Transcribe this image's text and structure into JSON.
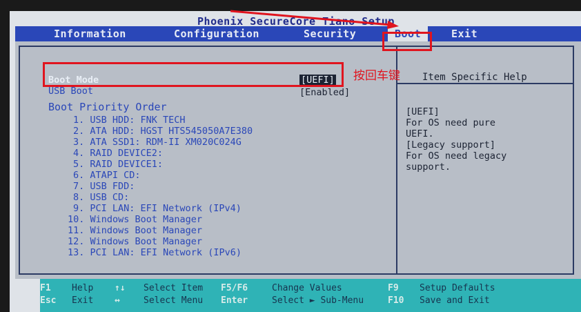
{
  "title": "Phoenix SecureCore Tiano Setup",
  "menu": [
    "Information",
    "Configuration",
    "Security",
    "Boot",
    "Exit"
  ],
  "active_tab": "Boot",
  "settings": {
    "boot_mode": {
      "label": "Boot Mode",
      "value": "[UEFI]"
    },
    "usb_boot": {
      "label": "USB Boot",
      "value": "[Enabled]"
    }
  },
  "boot_priority_heading": "Boot Priority Order",
  "boot_items": [
    "1. USB HDD: FNK TECH",
    "2. ATA HDD: HGST HTS545050A7E380",
    "3. ATA SSD1: RDM-II XM020C024G",
    "4. RAID DEVICE2:",
    "5. RAID DEVICE1:",
    "6. ATAPI CD:",
    "7. USB FDD:",
    "8. USB CD:",
    "9. PCI LAN: EFI Network (IPv4)",
    "10. Windows Boot Manager",
    "11. Windows Boot Manager",
    "12. Windows Boot Manager",
    "13. PCI LAN: EFI Network (IPv6)"
  ],
  "help": {
    "title": "Item Specific Help",
    "lines": [
      "[UEFI]",
      "For OS need pure",
      "UEFI.",
      "[Legacy support]",
      "For OS need legacy",
      "support."
    ]
  },
  "annotation": "按回车键",
  "footer": [
    {
      "key": "F1",
      "desc": "Help"
    },
    {
      "key": "Esc",
      "desc": "Exit"
    },
    {
      "key": "↑↓",
      "desc": "Select Item"
    },
    {
      "key": "↔",
      "desc": "Select Menu"
    },
    {
      "key": "F5/F6",
      "desc": "Change Values"
    },
    {
      "key": "Enter",
      "desc": "Select ► Sub-Menu"
    },
    {
      "key": "F9",
      "desc": "Setup Defaults"
    },
    {
      "key": "F10",
      "desc": "Save and Exit"
    }
  ],
  "colors": {
    "menu_bar": "#2a47b8",
    "annotation": "#e0141e",
    "footer": "#2fb3b6"
  }
}
